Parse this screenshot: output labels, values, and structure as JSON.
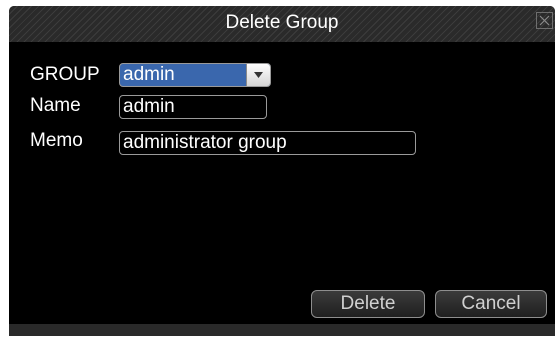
{
  "dialog": {
    "title": "Delete Group",
    "close_icon": "close-icon"
  },
  "form": {
    "group_label": "GROUP",
    "group_value": "admin",
    "name_label": "Name",
    "name_value": "admin",
    "memo_label": "Memo",
    "memo_value": "administrator group"
  },
  "buttons": {
    "delete_label": "Delete",
    "cancel_label": "Cancel"
  },
  "colors": {
    "background": "#000000",
    "select_highlight": "#3a67ad",
    "text": "#ffffff"
  }
}
